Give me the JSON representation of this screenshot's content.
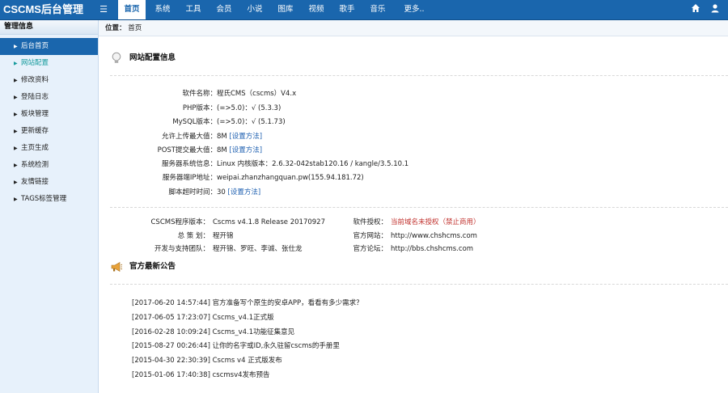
{
  "app_title": "CSCMS后台管理",
  "nav": [
    "首页",
    "系统",
    "工具",
    "会员",
    "小说",
    "图库",
    "视频",
    "歌手",
    "音乐",
    "更多.."
  ],
  "sidebar": {
    "heading": "管理信息",
    "items": [
      "后台首页",
      "网站配置",
      "修改资料",
      "登陆日志",
      "板块管理",
      "更新缓存",
      "主页生成",
      "系统检测",
      "友情链接",
      "TAGS标签管理"
    ]
  },
  "breadcrumb": {
    "label": "位置：",
    "current": "首页"
  },
  "config": {
    "heading": "网站配置信息",
    "rows": [
      {
        "label": "软件名称：",
        "value": "程氏CMS（cscms）V4.x",
        "link": ""
      },
      {
        "label": "PHP版本：",
        "value": "(=>5.0)：√  (5.3.3)",
        "link": ""
      },
      {
        "label": "MySQL版本：",
        "value": "(=>5.0)：√  (5.1.73)",
        "link": ""
      },
      {
        "label": "允许上传最大值：",
        "value": "8M",
        "link": "[设置方法]"
      },
      {
        "label": "POST提交最大值：",
        "value": "8M",
        "link": "[设置方法]"
      },
      {
        "label": "服务器系统信息：",
        "value": "Linux  内核版本：2.6.32-042stab120.16 / kangle/3.5.10.1",
        "link": ""
      },
      {
        "label": "服务器端IP地址：",
        "value": "weipai.zhanzhangquan.pw(155.94.181.72)",
        "link": ""
      },
      {
        "label": "脚本超时时间：",
        "value": "30",
        "link": "[设置方法]"
      }
    ]
  },
  "version": {
    "left": [
      {
        "label": "CSCMS程序版本：",
        "value": "Cscms v4.1.8 Release 20170927"
      },
      {
        "label": "总 策 划：",
        "value": "程开锦"
      },
      {
        "label": "开发与支持团队：",
        "value": "程开锦、罗旺、李诚、张仕龙"
      }
    ],
    "right": [
      {
        "label": "软件授权：",
        "value": "当前域名未授权（禁止商用）",
        "red": true
      },
      {
        "label": "官方网站：",
        "value": "http://www.chshcms.com",
        "red": false
      },
      {
        "label": "官方论坛：",
        "value": "http://bbs.chshcms.com",
        "red": false
      }
    ]
  },
  "news": {
    "heading": "官方最新公告",
    "items": [
      "[2017-06-20 14:57:44] 官方准备写个原生的安卓APP，看看有多少需求？",
      "[2017-06-05 17:23:07] Cscms_v4.1正式版",
      "[2016-02-28 10:09:24] Cscms_v4.1功能征集意见",
      "[2015-08-27 00:26:44] 让你的名字或ID,永久驻留cscms的手册里",
      "[2015-04-30 22:30:39] Cscms v4 正式版发布",
      "[2015-01-06 17:40:38] cscmsv4发布预告"
    ]
  },
  "colors": {
    "topbar": "#1a66ad",
    "sidebar_bg": "#e7f1fb",
    "active": "#1a66ad",
    "warning": "#c0302c"
  }
}
